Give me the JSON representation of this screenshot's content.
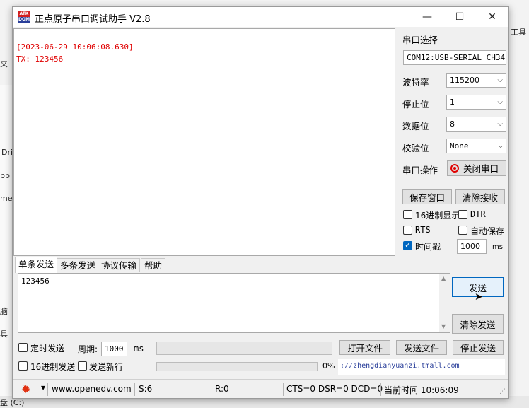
{
  "background": {
    "fragments": [
      "工具",
      "夹",
      "Dri",
      "pp",
      "ment",
      "脑",
      "具",
      "盘 (C:)"
    ]
  },
  "window": {
    "title": "正点原子串口调试助手 V2.8",
    "logo_top": "ATK",
    "logo_bottom": "DOM",
    "controls": {
      "minimize": "—",
      "maximize": "☐",
      "close": "✕"
    }
  },
  "receive": {
    "lines": [
      "[2023-06-29 10:06:08.630]",
      "TX: 123456"
    ]
  },
  "panel": {
    "port_label": "串口选择",
    "port_value": "COM12:USB-SERIAL CH34",
    "baud_label": "波特率",
    "baud_value": "115200",
    "stop_label": "停止位",
    "stop_value": "1",
    "data_label": "数据位",
    "data_value": "8",
    "parity_label": "校验位",
    "parity_value": "None",
    "op_label": "串口操作",
    "close_port": "关闭串口",
    "save_window": "保存窗口",
    "clear_recv": "清除接收",
    "hex_display": "16进制显示",
    "dtr": "DTR",
    "rts": "RTS",
    "auto_save": "自动保存",
    "timestamp": "时间戳",
    "timestamp_value": "1000",
    "timestamp_unit": "ms"
  },
  "tabs": [
    "单条发送",
    "多条发送",
    "协议传输",
    "帮助"
  ],
  "send": {
    "text": "123456",
    "send_btn": "发送",
    "clear_send": "清除发送",
    "timed_send": "定时发送",
    "period_label": "周期:",
    "period_value": "1000",
    "period_unit": "ms",
    "open_file": "打开文件",
    "send_file": "发送文件",
    "stop_send": "停止发送",
    "hex_send": "16进制发送",
    "send_newline": "发送新行",
    "progress_text": "0%",
    "progress": 0,
    "url": "://zhengdianyuanzi.tmall.com"
  },
  "status": {
    "site": "www.openedv.com",
    "sent": "S:6",
    "recv": "R:0",
    "signals": "CTS=0 DSR=0 DCD=0",
    "time": "当前时间 10:06:09"
  },
  "colors": {
    "accent": "#0067c0",
    "rx_text": "#e00000",
    "record": "#e00000"
  }
}
